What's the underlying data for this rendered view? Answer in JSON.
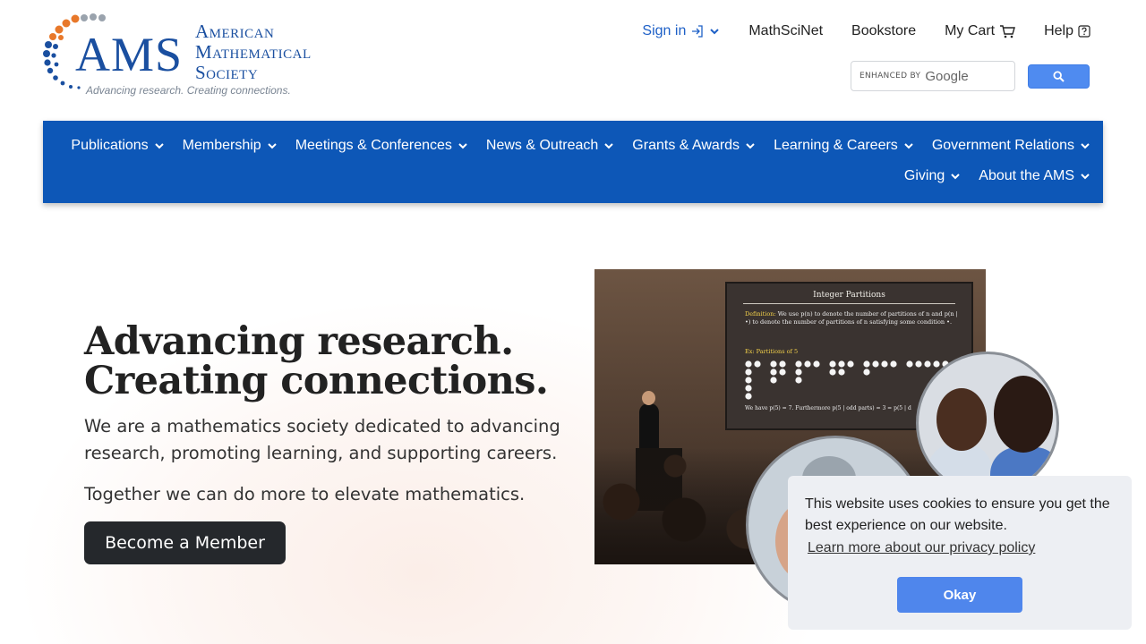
{
  "brand": {
    "logo_text": "AMS",
    "name_lines": [
      "American",
      "Mathematical",
      "Society"
    ],
    "tagline": "Advancing research. Creating connections."
  },
  "utility_nav": {
    "sign_in": "Sign in",
    "mathscinet": "MathSciNet",
    "bookstore": "Bookstore",
    "my_cart": "My Cart",
    "help": "Help"
  },
  "search": {
    "enhanced_by": "ENHANCED BY",
    "google": "Google"
  },
  "main_nav": {
    "row1": [
      "Publications",
      "Membership",
      "Meetings & Conferences",
      "News & Outreach",
      "Grants & Awards",
      "Learning & Careers",
      "Government Relations"
    ],
    "row2": [
      "Giving",
      "About the AMS"
    ]
  },
  "hero": {
    "title_line1": "Advancing research.",
    "title_line2": "Creating connections.",
    "description": "We are a mathematics society dedicated to advancing research, promoting learning, and supporting careers.",
    "tagline": "Together we can do more to elevate mathematics.",
    "cta": "Become a Member"
  },
  "slide": {
    "title": "Integer Partitions",
    "definition_label": "Definition:",
    "definition": "We use p(n) to denote the number of partitions of n and p(n | •) to denote the number of partitions of n satisfying some condition •.",
    "example_label": "Ex: Partitions of 5",
    "bottom": "We have p(5) = 7. Furthermore p(5 | odd parts) = 3 = p(5 | d"
  },
  "cookie": {
    "message": "This website uses cookies to ensure you get the best experience on our website.",
    "link": "Learn more about our privacy policy",
    "ok": "Okay"
  },
  "colors": {
    "brand_blue": "#1a4fa0",
    "nav_blue": "#0d57b7",
    "link_blue": "#1e60c7",
    "button_dark": "#25282c",
    "cookie_button": "#4f86ec"
  }
}
